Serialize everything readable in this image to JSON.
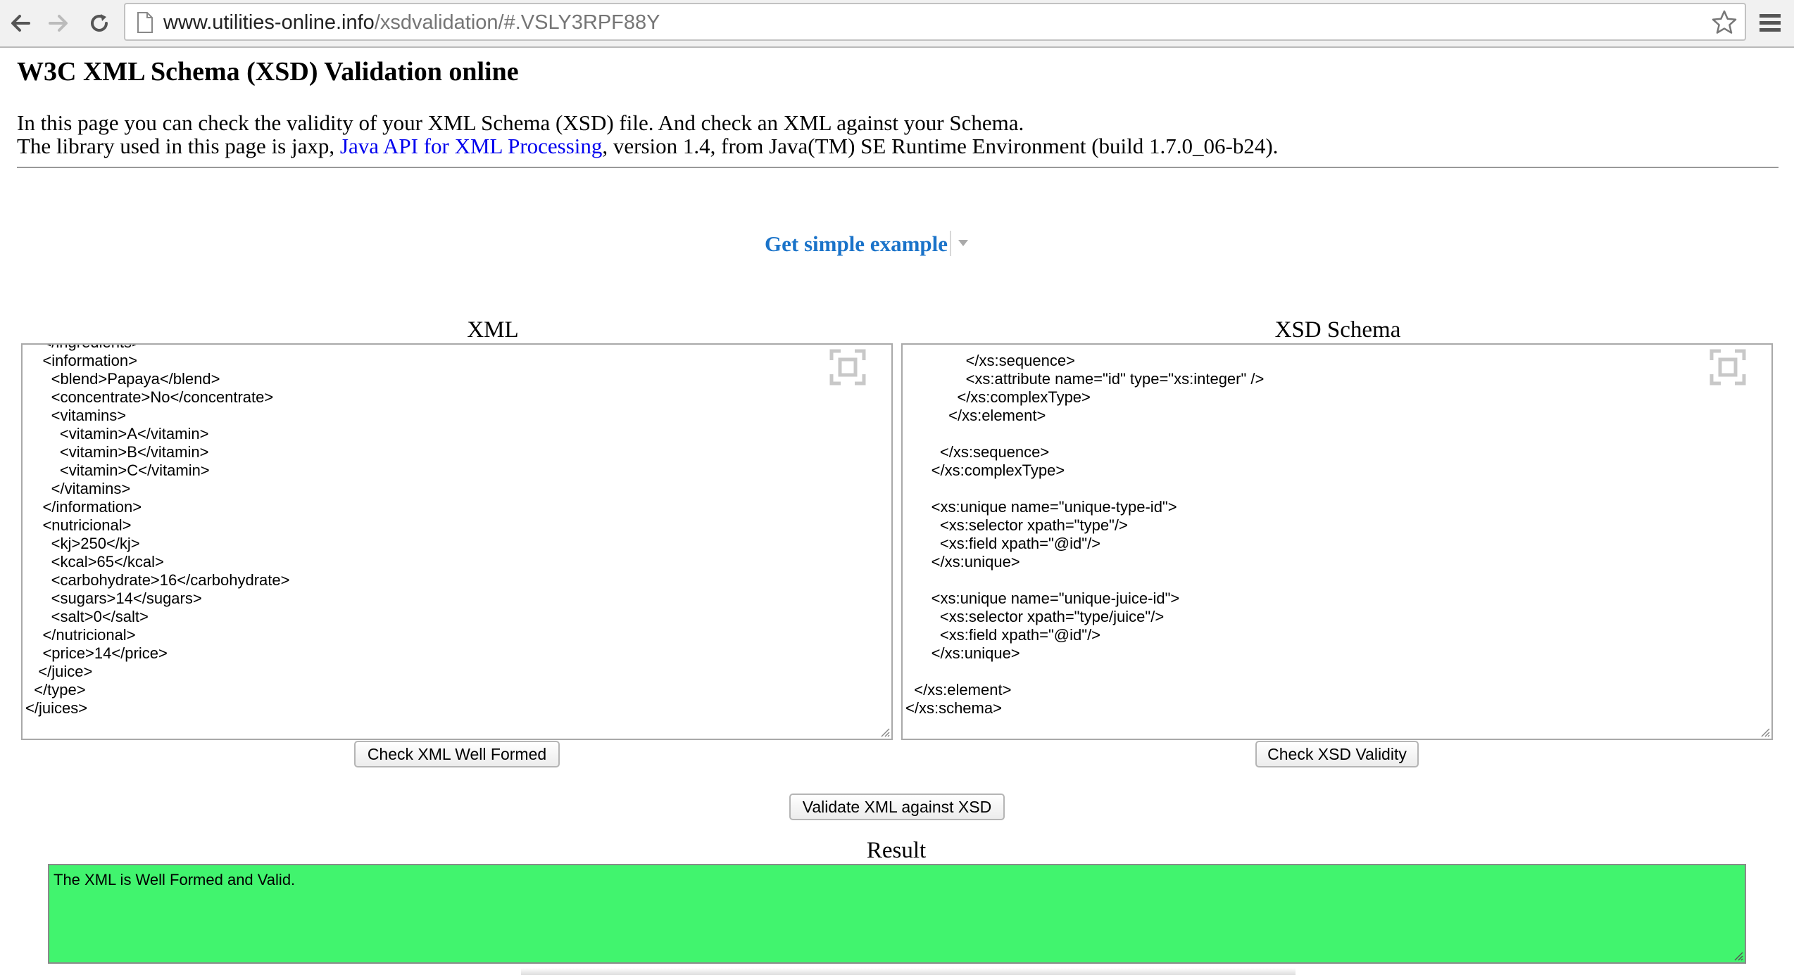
{
  "browser": {
    "url_host": "www.utilities-online.info",
    "url_path": "/xsdvalidation/#.VSLY3RPF88Y"
  },
  "page": {
    "title": "W3C XML Schema (XSD) Validation online",
    "intro_line1": "In this page you can check the validity of your XML Schema (XSD) file. And check an XML against your Schema.",
    "intro_line2_prefix": "The library used in this page is jaxp, ",
    "intro_link": "Java API for XML Processing",
    "intro_line2_suffix": ", version 1.4, from Java(TM) SE Runtime Environment (build 1.7.0_06-b24).",
    "example_label": "Get simple example"
  },
  "xml_panel": {
    "label": "XML",
    "content": "    </ingredients>\n    <information>\n      <blend>Papaya</blend>\n      <concentrate>No</concentrate>\n      <vitamins>\n        <vitamin>A</vitamin>\n        <vitamin>B</vitamin>\n        <vitamin>C</vitamin>\n      </vitamins>\n    </information>\n    <nutricional>\n      <kj>250</kj>\n      <kcal>65</kcal>\n      <carbohydrate>16</carbohydrate>\n      <sugars>14</sugars>\n      <salt>0</salt>\n    </nutricional>\n    <price>14</price>\n   </juice>\n  </type>\n</juices>",
    "button": "Check XML Well Formed"
  },
  "xsd_panel": {
    "label": "XSD Schema",
    "content": "              </xs:sequence>\n              <xs:attribute name=\"id\" type=\"xs:integer\" />\n            </xs:complexType>\n          </xs:element>\n\n        </xs:sequence>\n      </xs:complexType>\n\n      <xs:unique name=\"unique-type-id\">\n        <xs:selector xpath=\"type\"/>\n        <xs:field xpath=\"@id\"/>\n      </xs:unique>\n\n      <xs:unique name=\"unique-juice-id\">\n        <xs:selector xpath=\"type/juice\"/>\n        <xs:field xpath=\"@id\"/>\n      </xs:unique>\n\n  </xs:element>\n</xs:schema>",
    "button": "Check XSD Validity"
  },
  "validate_button": "Validate XML against XSD",
  "result": {
    "label": "Result",
    "text": "The XML is Well Formed and Valid.",
    "color": "#41f46e"
  },
  "icons": {
    "back": "back-arrow-icon",
    "forward": "forward-arrow-icon",
    "reload": "reload-icon",
    "page": "page-icon",
    "bookmark": "star-icon",
    "menu": "hamburger-menu-icon",
    "fullscreen": "fullscreen-icon",
    "resize": "resize-grip-icon"
  }
}
